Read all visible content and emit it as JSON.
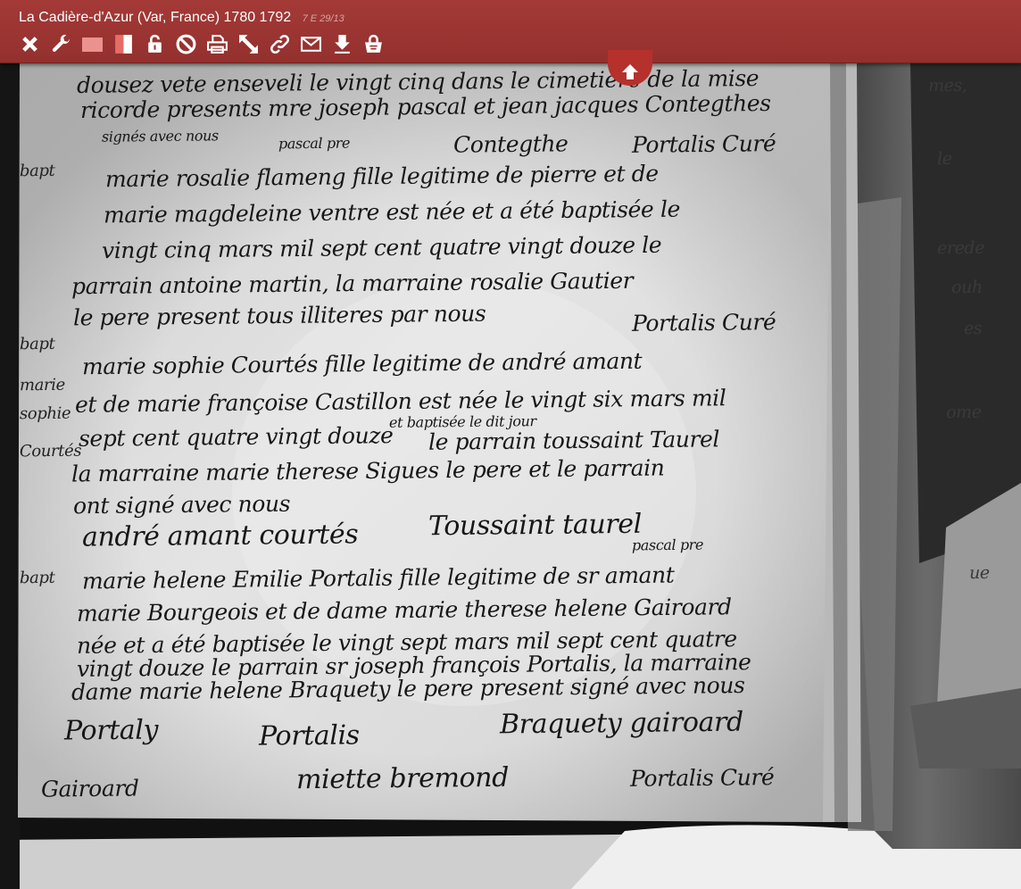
{
  "header": {
    "title": "La Cadière-d'Azur (Var, France) 1780 1792",
    "cote": "7 E 29/13"
  },
  "toolbar_icons": [
    {
      "name": "close-icon",
      "color": "#ffffff"
    },
    {
      "name": "wrench-icon",
      "color": "#ffffff"
    },
    {
      "name": "single-page-icon",
      "color": "#ffffff"
    },
    {
      "name": "double-page-icon",
      "color": "#ffffff"
    },
    {
      "name": "unlock-icon",
      "color": "#ffffff"
    },
    {
      "name": "forbidden-icon",
      "color": "#ffffff"
    },
    {
      "name": "print-icon",
      "color": "#ffffff"
    },
    {
      "name": "resize-arrow-icon",
      "color": "#ffffff"
    },
    {
      "name": "link-icon",
      "color": "#ffffff"
    },
    {
      "name": "mail-icon",
      "color": "#ffffff"
    },
    {
      "name": "download-icon",
      "color": "#ffffff"
    },
    {
      "name": "cart-lock-icon",
      "color": "#ffffff"
    }
  ],
  "colors": {
    "toolbar": "#9a3431",
    "accent": "#b6302c",
    "paper": "#dcdcdc"
  },
  "document": {
    "lines": [
      "dousez vete enseveli le vingt cinq dans le cimetiere de la mise",
      "ricorde presents mre joseph pascal et jean jacques Contegthes",
      "signés avec nous",
      "pascal pre",
      "Contegthe",
      "Portalis Curé",
      "marie rosalie flameng fille legitime de pierre et de",
      "marie magdeleine ventre est née et a été baptisée le",
      "vingt cinq mars mil sept cent quatre vingt douze le",
      "parrain antoine martin, la marraine rosalie Gautier",
      "le pere present tous illiteres par nous",
      "Portalis Curé",
      "marie sophie Courtés fille legitime de andré amant",
      "et de marie françoise Castillon est née le vingt six mars mil",
      "sept cent quatre vingt douze",
      "et baptisée le dit jour",
      "le parrain toussaint Taurel",
      "la marraine marie therese Sigues le pere et le parrain",
      "ont signé avec nous",
      "andré amant courtés",
      "Toussaint taurel",
      "pascal pre",
      "marie helene Emilie Portalis fille legitime de sr amant",
      "marie Bourgeois et de dame marie therese helene Gairoard",
      "née et a été baptisée le vingt sept mars mil sept cent quatre",
      "vingt douze le parrain sr joseph françois Portalis, la marraine",
      "dame marie helene Braquety le pere present signé avec nous",
      "Portaly",
      "Portalis",
      "Braquety gairoard",
      "Gairoard",
      "miette bremond",
      "Portalis Curé"
    ],
    "margin_notes": [
      "bapt",
      "bapt",
      "marie",
      "sophie",
      "Courtés",
      "bapt"
    ],
    "right_page_fragments": [
      "mes,",
      "le",
      "erede",
      "ouh",
      "es",
      "ome",
      "ue"
    ]
  }
}
